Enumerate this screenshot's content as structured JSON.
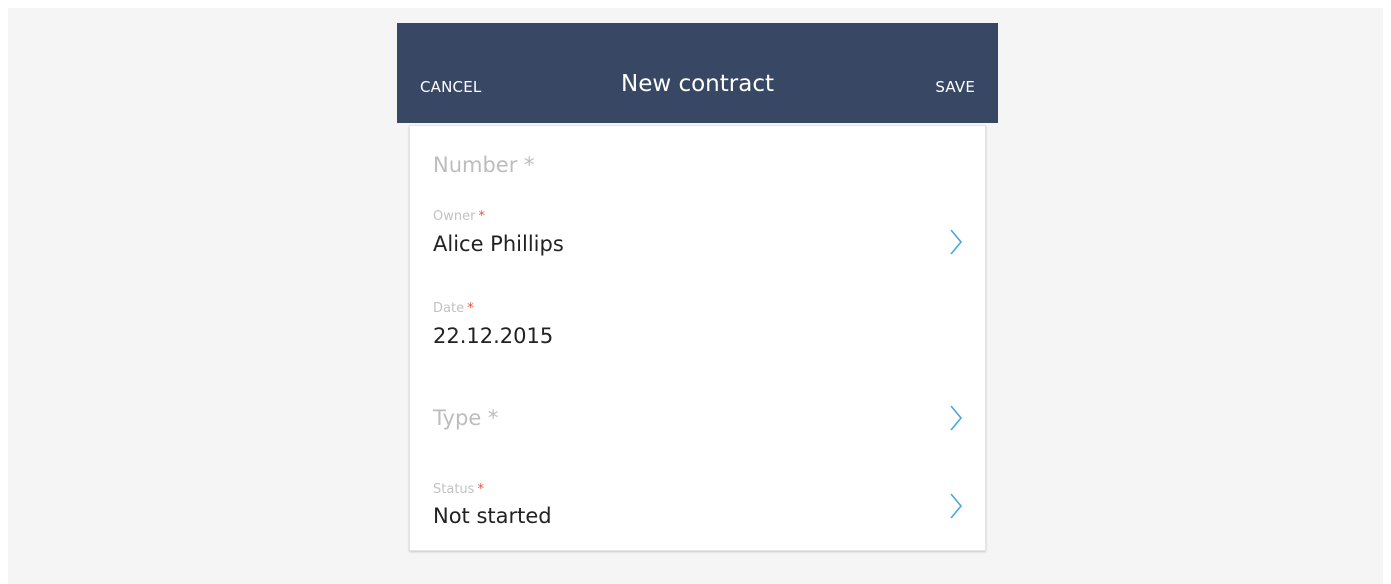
{
  "header": {
    "cancel_label": "CANCEL",
    "title": "New contract",
    "save_label": "SAVE"
  },
  "fields": {
    "number": {
      "placeholder": "Number",
      "required_mark": "*"
    },
    "owner": {
      "label": "Owner",
      "required_mark": "*",
      "value": "Alice Phillips"
    },
    "date": {
      "label": "Date",
      "required_mark": "*",
      "value": "22.12.2015"
    },
    "type": {
      "placeholder": "Type",
      "required_mark": "*"
    },
    "status": {
      "label": "Status",
      "required_mark": "*",
      "value": "Not started"
    }
  },
  "colors": {
    "header_bg": "#374764",
    "required_mark": "#e8553c",
    "chevron": "#4aa8e0"
  },
  "icons": {
    "chevron": "chevron-right-icon"
  }
}
